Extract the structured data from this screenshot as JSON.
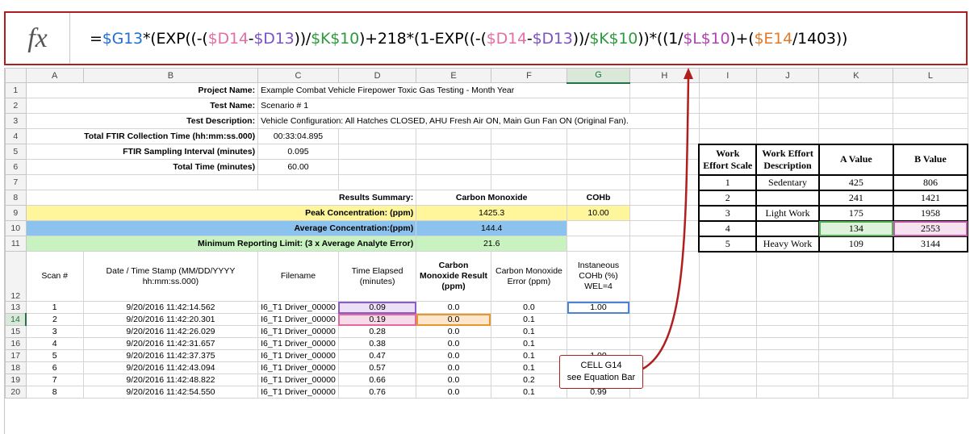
{
  "formula_bar": {
    "fx_label": "fx",
    "formula_parts": [
      {
        "t": "=",
        "c": "plain"
      },
      {
        "t": "$G13",
        "c": "f-g"
      },
      {
        "t": "*(EXP((-(",
        "c": "plain"
      },
      {
        "t": "$D14",
        "c": "f-d"
      },
      {
        "t": "-",
        "c": "plain"
      },
      {
        "t": "$D13",
        "c": "f-d2"
      },
      {
        "t": "))/",
        "c": "plain"
      },
      {
        "t": "$K$10",
        "c": "f-k"
      },
      {
        "t": ")+218*(1-EXP((-(",
        "c": "plain"
      },
      {
        "t": "$D14",
        "c": "f-d"
      },
      {
        "t": "-",
        "c": "plain"
      },
      {
        "t": "$D13",
        "c": "f-d2"
      },
      {
        "t": "))/",
        "c": "plain"
      },
      {
        "t": "$K$10",
        "c": "f-k"
      },
      {
        "t": "))*((1/",
        "c": "plain"
      },
      {
        "t": "$L$10",
        "c": "f-l"
      },
      {
        "t": ")+(",
        "c": "plain"
      },
      {
        "t": "$E14",
        "c": "f-e"
      },
      {
        "t": "/1403))",
        "c": "plain"
      }
    ]
  },
  "columns": [
    "A",
    "B",
    "C",
    "D",
    "E",
    "F",
    "G",
    "H",
    "I",
    "J",
    "K",
    "L"
  ],
  "selected_column": "G",
  "selected_row": "14",
  "meta": {
    "project_label": "Project Name:",
    "project_value": "Example Combat Vehicle Firepower Toxic Gas Testing - Month Year",
    "test_label": "Test Name:",
    "test_value": "Scenario # 1",
    "desc_label": "Test Description:",
    "desc_value": "Vehicle Configuration: All Hatches CLOSED, AHU Fresh Air ON, Main Gun Fan ON (Original Fan).",
    "ftir_label": "Total FTIR Collection Time (hh:mm:ss.000)",
    "ftir_value": "00:33:04.895",
    "interval_label": "FTIR Sampling Interval (minutes)",
    "interval_value": "0.095",
    "total_label": "Total Time (minutes)",
    "total_value": "60.00"
  },
  "summary": {
    "label": "Results Summary:",
    "col_e": "Carbon Monoxide",
    "col_g": "COHb",
    "peak_label": "Peak Concentration: (ppm)",
    "peak_e": "1425.3",
    "peak_g": "10.00",
    "avg_label": "Average Concentration:(ppm)",
    "avg_e": "144.4",
    "mrl_label": "Minimum Reporting Limit: (3 x Average Analyte Error)",
    "mrl_e": "21.6"
  },
  "data_headers": {
    "scan": "Scan #",
    "timestamp": "Date / Time Stamp (MM/DD/YYYY  hh:mm:ss.000)",
    "filename": "Filename",
    "elapsed": "Time Elapsed (minutes)",
    "co_result": "Carbon Monoxide Result (ppm)",
    "co_error": "Carbon Monoxide Error (ppm)",
    "cohb": "Instaneous COHb (%) WEL=4"
  },
  "rows": [
    {
      "n": "13",
      "scan": "1",
      "ts": "9/20/2016 11:42:14.562",
      "file": "I6_T1 Driver_00000",
      "el": "0.09",
      "co": "0.0",
      "err": "0.0",
      "cohb": "1.00"
    },
    {
      "n": "14",
      "scan": "2",
      "ts": "9/20/2016 11:42:20.301",
      "file": "I6_T1 Driver_00000",
      "el": "0.19",
      "co": "0.0",
      "err": "0.1",
      "cohb": ""
    },
    {
      "n": "15",
      "scan": "3",
      "ts": "9/20/2016 11:42:26.029",
      "file": "I6_T1 Driver_00000",
      "el": "0.28",
      "co": "0.0",
      "err": "0.1",
      "cohb": ""
    },
    {
      "n": "16",
      "scan": "4",
      "ts": "9/20/2016 11:42:31.657",
      "file": "I6_T1 Driver_00000",
      "el": "0.38",
      "co": "0.0",
      "err": "0.1",
      "cohb": ""
    },
    {
      "n": "17",
      "scan": "5",
      "ts": "9/20/2016 11:42:37.375",
      "file": "I6_T1 Driver_00000",
      "el": "0.47",
      "co": "0.0",
      "err": "0.1",
      "cohb": "1.00"
    },
    {
      "n": "18",
      "scan": "6",
      "ts": "9/20/2016 11:42:43.094",
      "file": "I6_T1 Driver_00000",
      "el": "0.57",
      "co": "0.0",
      "err": "0.1",
      "cohb": "1.00"
    },
    {
      "n": "19",
      "scan": "7",
      "ts": "9/20/2016 11:42:48.822",
      "file": "I6_T1 Driver_00000",
      "el": "0.66",
      "co": "0.0",
      "err": "0.2",
      "cohb": "1.00"
    },
    {
      "n": "20",
      "scan": "8",
      "ts": "9/20/2016 11:42:54.550",
      "file": "I6_T1 Driver_00000",
      "el": "0.76",
      "co": "0.0",
      "err": "0.1",
      "cohb": "0.99"
    }
  ],
  "work_effort": {
    "h_scale": "Work Effort Scale",
    "h_desc": "Work Effort Description",
    "h_a": "A Value",
    "h_b": "B Value",
    "rows": [
      {
        "scale": "1",
        "desc": "Sedentary",
        "a": "425",
        "b": "806"
      },
      {
        "scale": "2",
        "desc": "",
        "a": "241",
        "b": "1421"
      },
      {
        "scale": "3",
        "desc": "Light Work",
        "a": "175",
        "b": "1958"
      },
      {
        "scale": "4",
        "desc": "",
        "a": "134",
        "b": "2553"
      },
      {
        "scale": "5",
        "desc": "Heavy Work",
        "a": "109",
        "b": "3144"
      }
    ]
  },
  "callout": {
    "line1": "CELL G14",
    "line2": "see Equation Bar"
  },
  "colors": {
    "frame_red": "#b01e1e",
    "peak_yellow": "#fff59a",
    "avg_blue": "#8cc3ee",
    "mrl_green": "#c8f3c0",
    "excel_green": "#217346"
  }
}
